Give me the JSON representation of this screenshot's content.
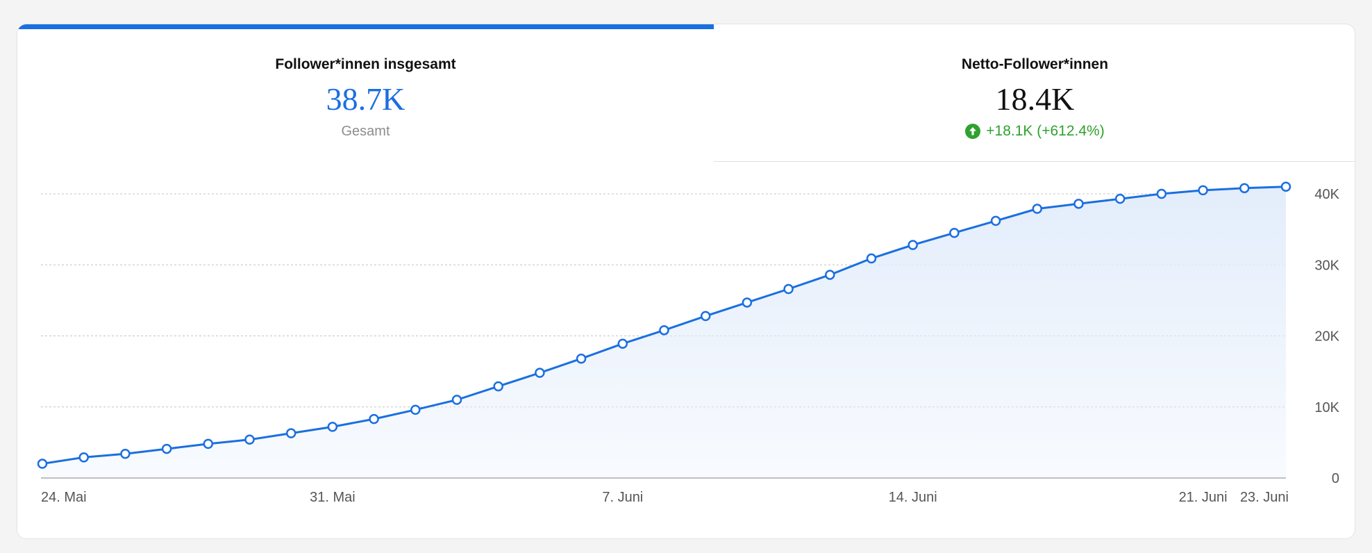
{
  "tabs": [
    {
      "title": "Follower*innen insgesamt",
      "value": "38.7K",
      "sub": "Gesamt"
    },
    {
      "title": "Netto-Follower*innen",
      "value": "18.4K",
      "delta": "+18.1K (+612.4%)"
    }
  ],
  "colors": {
    "accent": "#1a6fe0",
    "positive": "#2ea12e",
    "area_fill": "#e3edfb"
  },
  "icons": {
    "delta": "arrow-up-circle-icon"
  },
  "chart_data": {
    "type": "area",
    "title": "",
    "xlabel": "",
    "ylabel": "",
    "ylim": [
      0,
      40000
    ],
    "y_ticks": [
      {
        "value": 0,
        "label": "0"
      },
      {
        "value": 10000,
        "label": "10K"
      },
      {
        "value": 20000,
        "label": "20K"
      },
      {
        "value": 30000,
        "label": "30K"
      },
      {
        "value": 40000,
        "label": "40K"
      }
    ],
    "grid": true,
    "x_ticks": [
      {
        "index": 0,
        "label": "24. Mai"
      },
      {
        "index": 7,
        "label": "31. Mai"
      },
      {
        "index": 14,
        "label": "7. Juni"
      },
      {
        "index": 21,
        "label": "14. Juni"
      },
      {
        "index": 28,
        "label": "21. Juni"
      },
      {
        "index": 30,
        "label": "23. Juni"
      }
    ],
    "x": [
      "24. Mai",
      "25. Mai",
      "26. Mai",
      "27. Mai",
      "28. Mai",
      "29. Mai",
      "30. Mai",
      "31. Mai",
      "1. Juni",
      "2. Juni",
      "3. Juni",
      "4. Juni",
      "5. Juni",
      "6. Juni",
      "7. Juni",
      "8. Juni",
      "9. Juni",
      "10. Juni",
      "11. Juni",
      "12. Juni",
      "13. Juni",
      "14. Juni",
      "15. Juni",
      "16. Juni",
      "17. Juni",
      "18. Juni",
      "19. Juni",
      "20. Juni",
      "21. Juni",
      "22. Juni",
      "23. Juni"
    ],
    "series": [
      {
        "values": [
          2000,
          2900,
          3400,
          4100,
          4800,
          5400,
          6300,
          7200,
          8300,
          9600,
          11000,
          12900,
          14800,
          16800,
          18900,
          20800,
          22800,
          24700,
          26600,
          28600,
          30900,
          32800,
          34500,
          36200,
          37900,
          38600,
          39300,
          40000,
          40500,
          40800,
          41000
        ]
      }
    ]
  }
}
